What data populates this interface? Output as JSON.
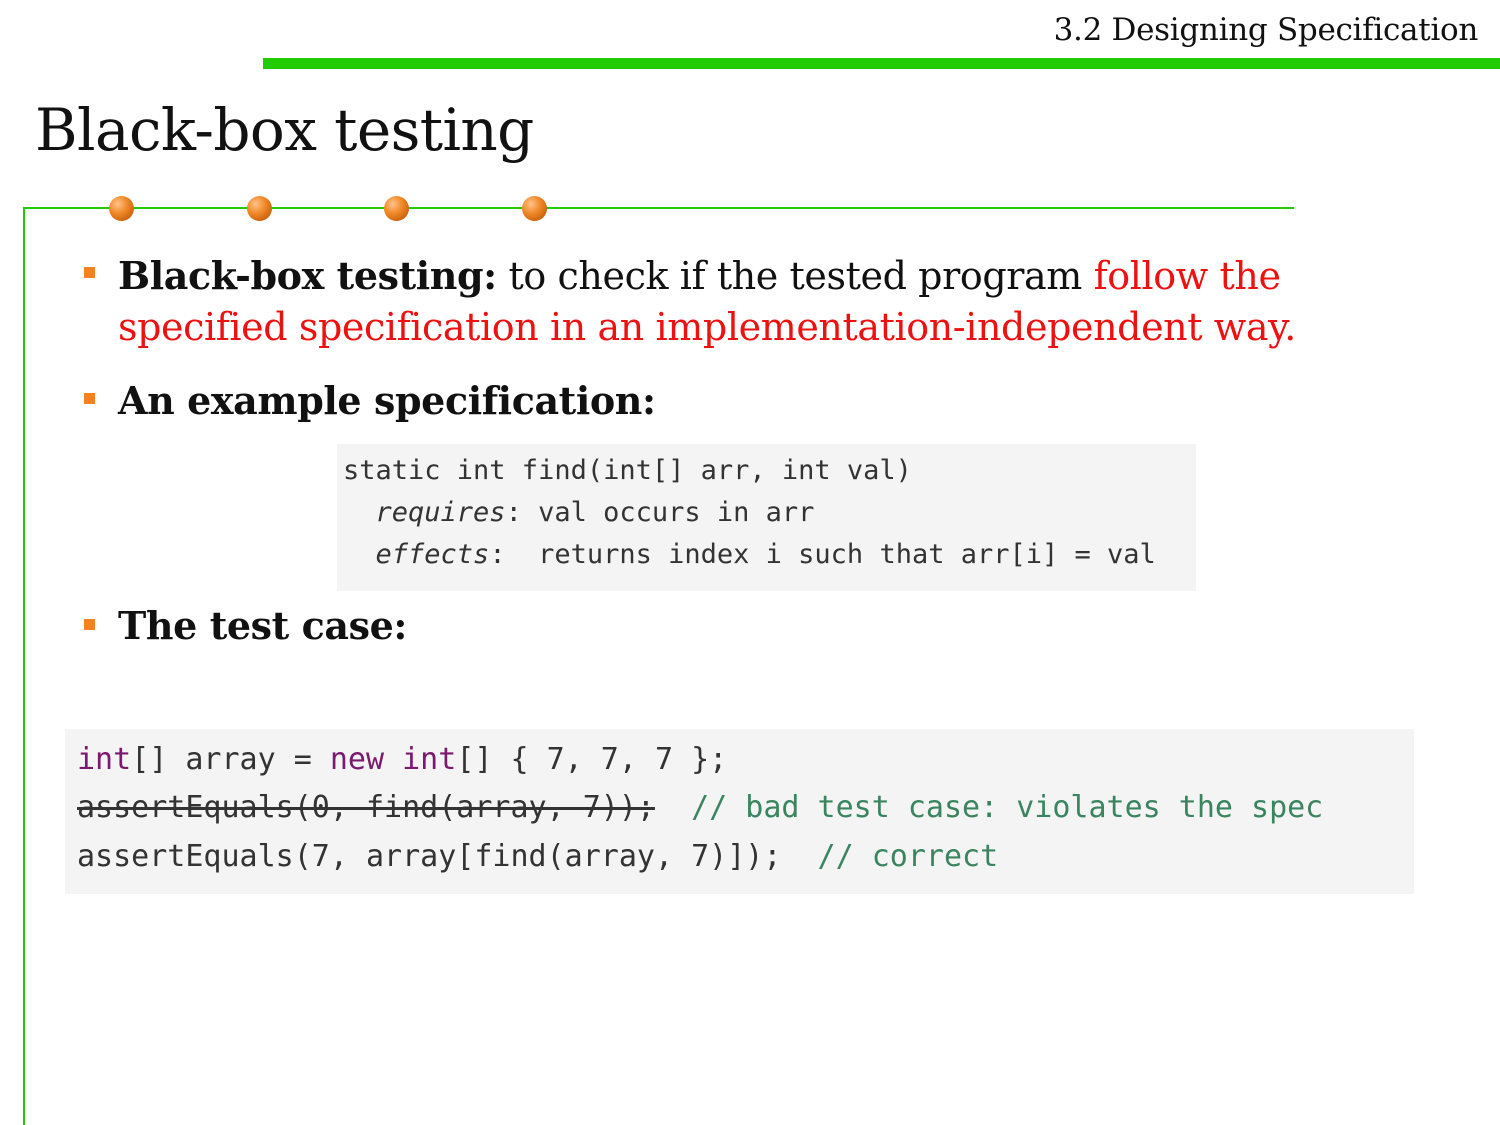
{
  "header": {
    "section_label": "3.2 Designing Specification",
    "title": "Black-box testing"
  },
  "colors": {
    "accent_green": "#22cc00",
    "bullet_orange": "#f5821f",
    "dot_orange": "#f08a2a",
    "emphasis_red": "#ee1111",
    "code_keyword": "#7a1a6e",
    "code_comment": "#3a8560",
    "code_background": "#f4f4f4"
  },
  "bullets": [
    {
      "term": "Black-box testing:",
      "text": " to check if the tested program ",
      "emphasis": "follow the specified specification in an implementation-independent way."
    },
    {
      "term": "An example specification:"
    },
    {
      "term": "The test case:"
    }
  ],
  "spec": {
    "signature": "static int find(int[] arr, int val)",
    "requires_label": "requires",
    "requires_text": ": val occurs in arr",
    "effects_label": "effects",
    "effects_text": ":  returns index i such that arr[i] = val"
  },
  "test_case": {
    "line1": {
      "kw1": "int",
      "part1": "[] array = ",
      "kw2": "new",
      "space": " ",
      "kw3": "int",
      "part2": "[] { 7, 7, 7 };"
    },
    "line2": {
      "struck_code": "assertEquals(0, find(array, 7));",
      "gap": "  ",
      "comment": "// bad test case: violates the spec"
    },
    "line3": {
      "code": "assertEquals(7, array[find(array, 7)]);",
      "gap": "  ",
      "comment": "// correct"
    }
  }
}
